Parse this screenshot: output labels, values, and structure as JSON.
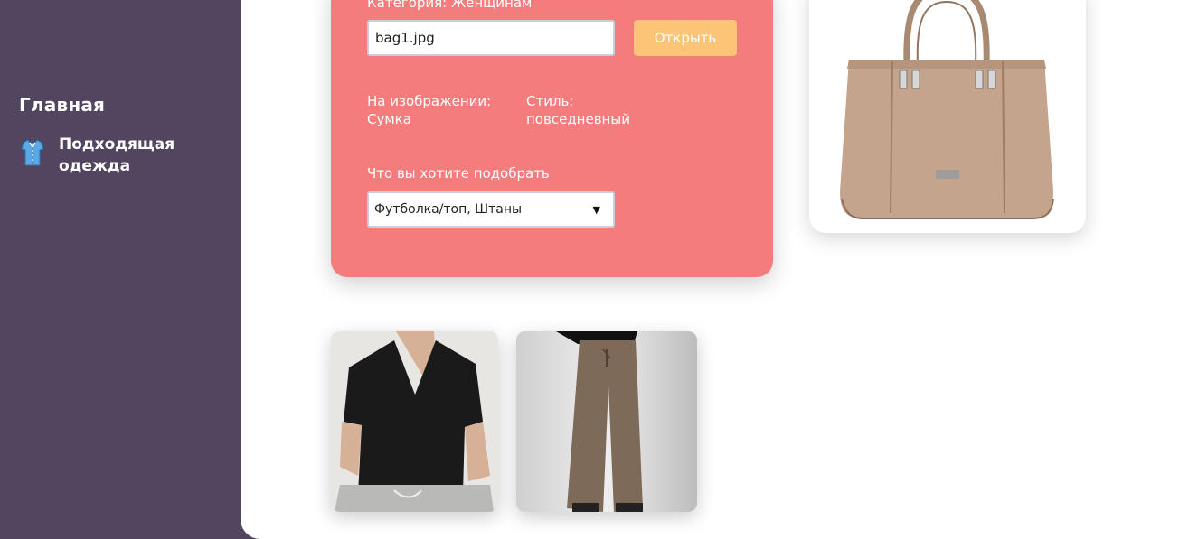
{
  "sidebar": {
    "title": "Главная",
    "items": [
      {
        "label": "Подходящая одежда",
        "icon": "shirt-icon"
      }
    ]
  },
  "form": {
    "category_text": "Категория: Женщинам",
    "file_value": "bag1.jpg",
    "open_button": "Открыть",
    "detected_label": "На изображении:",
    "detected_value": "Сумка",
    "style_label": "Стиль:",
    "style_value": "повседневный",
    "select_label": "Что вы хотите подобрать",
    "select_value": "Футболка/топ, Штаны"
  },
  "colors": {
    "sidebar": "#514560",
    "card": "#f47c7c",
    "button": "#fcc476"
  },
  "images": {
    "main": "handbag",
    "results": [
      "black-tshirt",
      "brown-wide-pants"
    ]
  }
}
